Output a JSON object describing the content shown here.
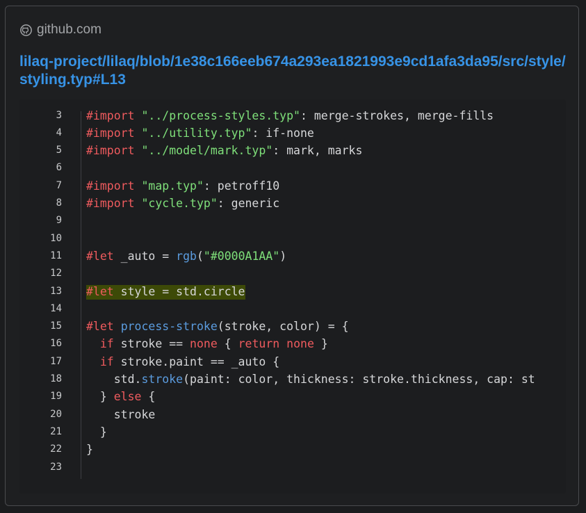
{
  "site": {
    "icon": "github-icon",
    "domain": "github.com"
  },
  "link": {
    "text": "lilaq-project/lilaq/blob/1e38c166eeb674a293ea1821993e9cd1afa3da95/src/style/styling.typ#L13"
  },
  "colors": {
    "keyword": "#ef5b5e",
    "string": "#7fe07a",
    "function": "#5b9cdf",
    "highlight": "#3d4a07",
    "link": "#3793e6"
  },
  "code": {
    "highlighted_line": "13",
    "lines": [
      {
        "num": "3",
        "tokens": [
          {
            "t": "kw",
            "v": "#import"
          },
          {
            "t": "plain",
            "v": " "
          },
          {
            "t": "str",
            "v": "\"../process-styles.typ\""
          },
          {
            "t": "plain",
            "v": ": merge-strokes, merge-fills"
          }
        ]
      },
      {
        "num": "4",
        "tokens": [
          {
            "t": "kw",
            "v": "#import"
          },
          {
            "t": "plain",
            "v": " "
          },
          {
            "t": "str",
            "v": "\"../utility.typ\""
          },
          {
            "t": "plain",
            "v": ": if-none"
          }
        ]
      },
      {
        "num": "5",
        "tokens": [
          {
            "t": "kw",
            "v": "#import"
          },
          {
            "t": "plain",
            "v": " "
          },
          {
            "t": "str",
            "v": "\"../model/mark.typ\""
          },
          {
            "t": "plain",
            "v": ": mark, marks"
          }
        ]
      },
      {
        "num": "6",
        "tokens": []
      },
      {
        "num": "7",
        "tokens": [
          {
            "t": "kw",
            "v": "#import"
          },
          {
            "t": "plain",
            "v": " "
          },
          {
            "t": "str",
            "v": "\"map.typ\""
          },
          {
            "t": "plain",
            "v": ": petroff10"
          }
        ]
      },
      {
        "num": "8",
        "tokens": [
          {
            "t": "kw",
            "v": "#import"
          },
          {
            "t": "plain",
            "v": " "
          },
          {
            "t": "str",
            "v": "\"cycle.typ\""
          },
          {
            "t": "plain",
            "v": ": generic"
          }
        ]
      },
      {
        "num": "9",
        "tokens": []
      },
      {
        "num": "10",
        "tokens": []
      },
      {
        "num": "11",
        "tokens": [
          {
            "t": "kw",
            "v": "#let"
          },
          {
            "t": "plain",
            "v": " _auto = "
          },
          {
            "t": "fn",
            "v": "rgb"
          },
          {
            "t": "plain",
            "v": "("
          },
          {
            "t": "str",
            "v": "\"#0000A1AA\""
          },
          {
            "t": "plain",
            "v": ")"
          }
        ]
      },
      {
        "num": "12",
        "tokens": []
      },
      {
        "num": "13",
        "highlight": true,
        "tokens": [
          {
            "t": "kw",
            "v": "#let"
          },
          {
            "t": "plain",
            "v": " style = std.circle"
          }
        ]
      },
      {
        "num": "14",
        "tokens": []
      },
      {
        "num": "15",
        "tokens": [
          {
            "t": "kw",
            "v": "#let"
          },
          {
            "t": "plain",
            "v": " "
          },
          {
            "t": "fn",
            "v": "process-stroke"
          },
          {
            "t": "plain",
            "v": "(stroke, color) = {"
          }
        ]
      },
      {
        "num": "16",
        "tokens": [
          {
            "t": "plain",
            "v": "  "
          },
          {
            "t": "kw",
            "v": "if"
          },
          {
            "t": "plain",
            "v": " stroke == "
          },
          {
            "t": "kw",
            "v": "none"
          },
          {
            "t": "plain",
            "v": " { "
          },
          {
            "t": "kw",
            "v": "return"
          },
          {
            "t": "plain",
            "v": " "
          },
          {
            "t": "kw",
            "v": "none"
          },
          {
            "t": "plain",
            "v": " }"
          }
        ]
      },
      {
        "num": "17",
        "tokens": [
          {
            "t": "plain",
            "v": "  "
          },
          {
            "t": "kw",
            "v": "if"
          },
          {
            "t": "plain",
            "v": " stroke.paint == _auto {"
          }
        ]
      },
      {
        "num": "18",
        "tokens": [
          {
            "t": "plain",
            "v": "    std."
          },
          {
            "t": "fn",
            "v": "stroke"
          },
          {
            "t": "plain",
            "v": "(paint: color, thickness: stroke.thickness, cap: st"
          }
        ]
      },
      {
        "num": "19",
        "tokens": [
          {
            "t": "plain",
            "v": "  } "
          },
          {
            "t": "kw",
            "v": "else"
          },
          {
            "t": "plain",
            "v": " {"
          }
        ]
      },
      {
        "num": "20",
        "tokens": [
          {
            "t": "plain",
            "v": "    stroke"
          }
        ]
      },
      {
        "num": "21",
        "tokens": [
          {
            "t": "plain",
            "v": "  }"
          }
        ]
      },
      {
        "num": "22",
        "tokens": [
          {
            "t": "plain",
            "v": "}"
          }
        ]
      },
      {
        "num": "23",
        "tokens": []
      }
    ]
  }
}
